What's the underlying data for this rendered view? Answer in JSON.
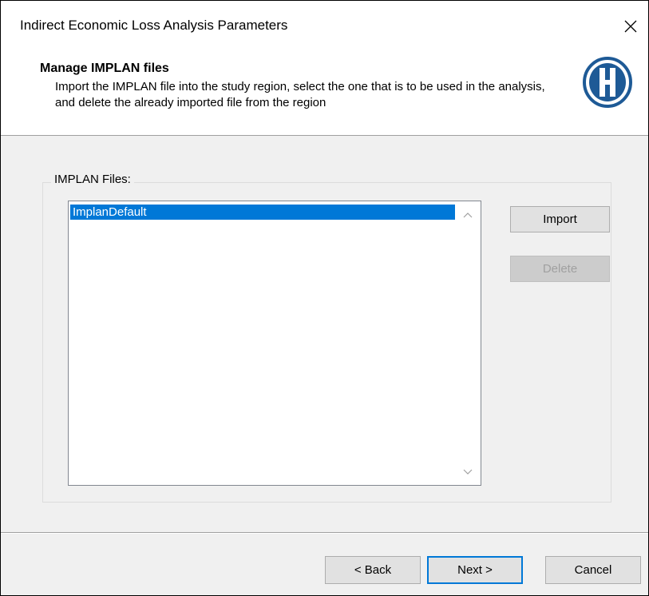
{
  "window": {
    "title": "Indirect Economic Loss Analysis Parameters",
    "close_icon": "close-icon"
  },
  "header": {
    "title": "Manage IMPLAN files",
    "description": "Import the IMPLAN file into the study region, select the one that is to be used in the analysis, and delete the already imported file from the region",
    "logo_icon": "hazus-logo-icon"
  },
  "files_group": {
    "label": "IMPLAN Files:",
    "items": [
      {
        "label": "ImplanDefault",
        "selected": true
      }
    ]
  },
  "actions": {
    "import_label": "Import",
    "delete_label": "Delete",
    "delete_enabled": false
  },
  "footer": {
    "back_label": "< Back",
    "next_label": "Next >",
    "cancel_label": "Cancel"
  },
  "colors": {
    "selection": "#0078d7",
    "logo": "#1e5a96",
    "default_button_border": "#0078d7"
  }
}
